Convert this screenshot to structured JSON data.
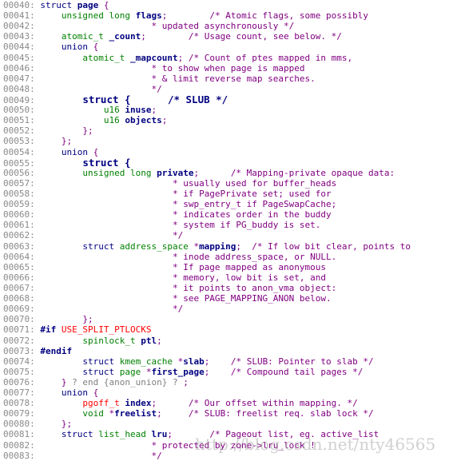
{
  "watermark": "http://blog.csdn.net/nty46565",
  "lines": [
    {
      "num": "00040:",
      "tokens": [
        [
          "k",
          "struct "
        ],
        [
          "i",
          "page"
        ],
        [
          "p",
          " {"
        ]
      ]
    },
    {
      "num": "00041:",
      "tokens": [
        [
          "s",
          "    "
        ],
        [
          "t",
          "unsigned long "
        ],
        [
          "i",
          "flags"
        ],
        [
          "p",
          ";"
        ],
        [
          "s",
          "        "
        ],
        [
          "c",
          "/* Atomic flags, some possibly"
        ]
      ]
    },
    {
      "num": "00042:",
      "tokens": [
        [
          "s",
          "                     "
        ],
        [
          "c",
          "* updated asynchronously */"
        ]
      ]
    },
    {
      "num": "00043:",
      "tokens": [
        [
          "s",
          "    "
        ],
        [
          "t",
          "atomic_t "
        ],
        [
          "i",
          "_count"
        ],
        [
          "p",
          ";"
        ],
        [
          "s",
          "        "
        ],
        [
          "c",
          "/* Usage count, see below. */"
        ]
      ]
    },
    {
      "num": "00044:",
      "tokens": [
        [
          "s",
          "    "
        ],
        [
          "k",
          "union"
        ],
        [
          "p",
          " {"
        ]
      ]
    },
    {
      "num": "00045:",
      "tokens": [
        [
          "s",
          "        "
        ],
        [
          "t",
          "atomic_t "
        ],
        [
          "i",
          "_mapcount"
        ],
        [
          "p",
          "; "
        ],
        [
          "c",
          "/* Count of ptes mapped in mms,"
        ]
      ]
    },
    {
      "num": "00046:",
      "tokens": [
        [
          "s",
          "                     "
        ],
        [
          "c",
          "* to show when page is mapped"
        ]
      ]
    },
    {
      "num": "00047:",
      "tokens": [
        [
          "s",
          "                     "
        ],
        [
          "c",
          "* & limit reverse map searches."
        ]
      ]
    },
    {
      "num": "00048:",
      "tokens": [
        [
          "s",
          "                     "
        ],
        [
          "c",
          "*/"
        ]
      ]
    },
    {
      "num": "00049:",
      "tokens": [
        [
          "s",
          "        "
        ],
        [
          "kb",
          "struct {"
        ],
        [
          "s",
          "       "
        ],
        [
          "kb",
          "/* SLUB */"
        ]
      ]
    },
    {
      "num": "00050:",
      "tokens": [
        [
          "s",
          "            "
        ],
        [
          "t",
          "u16 "
        ],
        [
          "i",
          "inuse"
        ],
        [
          "p",
          ";"
        ]
      ]
    },
    {
      "num": "00051:",
      "tokens": [
        [
          "s",
          "            "
        ],
        [
          "t",
          "u16 "
        ],
        [
          "i",
          "objects"
        ],
        [
          "p",
          ";"
        ]
      ]
    },
    {
      "num": "00052:",
      "tokens": [
        [
          "s",
          "        "
        ],
        [
          "p",
          "};"
        ]
      ]
    },
    {
      "num": "00053:",
      "tokens": [
        [
          "s",
          "    "
        ],
        [
          "p",
          "};"
        ]
      ]
    },
    {
      "num": "00054:",
      "tokens": [
        [
          "s",
          "    "
        ],
        [
          "k",
          "union"
        ],
        [
          "p",
          " {"
        ]
      ]
    },
    {
      "num": "00055:",
      "tokens": [
        [
          "s",
          "        "
        ],
        [
          "kb",
          "struct {"
        ]
      ]
    },
    {
      "num": "00056:",
      "tokens": [
        [
          "s",
          "        "
        ],
        [
          "t",
          "unsigned long "
        ],
        [
          "i",
          "private"
        ],
        [
          "p",
          ";"
        ],
        [
          "s",
          "      "
        ],
        [
          "c",
          "/* Mapping-private opaque data:"
        ]
      ]
    },
    {
      "num": "00057:",
      "tokens": [
        [
          "s",
          "                         "
        ],
        [
          "c",
          "* usually used for buffer_heads"
        ]
      ]
    },
    {
      "num": "00058:",
      "tokens": [
        [
          "s",
          "                         "
        ],
        [
          "c",
          "* if PagePrivate set; used for"
        ]
      ]
    },
    {
      "num": "00059:",
      "tokens": [
        [
          "s",
          "                         "
        ],
        [
          "c",
          "* swp_entry_t if PageSwapCache;"
        ]
      ]
    },
    {
      "num": "00060:",
      "tokens": [
        [
          "s",
          "                         "
        ],
        [
          "c",
          "* indicates order in the buddy"
        ]
      ]
    },
    {
      "num": "00061:",
      "tokens": [
        [
          "s",
          "                         "
        ],
        [
          "c",
          "* system if PG_buddy is set."
        ]
      ]
    },
    {
      "num": "00062:",
      "tokens": [
        [
          "s",
          "                         "
        ],
        [
          "c",
          "*/"
        ]
      ]
    },
    {
      "num": "00063:",
      "tokens": [
        [
          "s",
          "        "
        ],
        [
          "k",
          "struct "
        ],
        [
          "t",
          "address_space "
        ],
        [
          "p",
          "*"
        ],
        [
          "i",
          "mapping"
        ],
        [
          "p",
          ";"
        ],
        [
          "s",
          "  "
        ],
        [
          "c",
          "/* If low bit clear, points to"
        ]
      ]
    },
    {
      "num": "00064:",
      "tokens": [
        [
          "s",
          "                         "
        ],
        [
          "c",
          "* inode address_space, or NULL."
        ]
      ]
    },
    {
      "num": "00065:",
      "tokens": [
        [
          "s",
          "                         "
        ],
        [
          "c",
          "* If page mapped as anonymous"
        ]
      ]
    },
    {
      "num": "00066:",
      "tokens": [
        [
          "s",
          "                         "
        ],
        [
          "c",
          "* memory, low bit is set, and"
        ]
      ]
    },
    {
      "num": "00067:",
      "tokens": [
        [
          "s",
          "                         "
        ],
        [
          "c",
          "* it points to anon_vma object:"
        ]
      ]
    },
    {
      "num": "00068:",
      "tokens": [
        [
          "s",
          "                         "
        ],
        [
          "c",
          "* see PAGE_MAPPING_ANON below."
        ]
      ]
    },
    {
      "num": "00069:",
      "tokens": [
        [
          "s",
          "                         "
        ],
        [
          "c",
          "*/"
        ]
      ]
    },
    {
      "num": "00070:",
      "tokens": [
        [
          "s",
          "        "
        ],
        [
          "p",
          "};"
        ]
      ]
    },
    {
      "num": "00071:",
      "tokens": [
        [
          "pp",
          "#if "
        ],
        [
          "r",
          "USE_SPLIT_PTLOCKS"
        ]
      ]
    },
    {
      "num": "00072:",
      "tokens": [
        [
          "s",
          "        "
        ],
        [
          "t",
          "spinlock_t "
        ],
        [
          "i",
          "ptl"
        ],
        [
          "p",
          ";"
        ]
      ]
    },
    {
      "num": "00073:",
      "tokens": [
        [
          "pp",
          "#endif"
        ]
      ]
    },
    {
      "num": "00074:",
      "tokens": [
        [
          "s",
          "        "
        ],
        [
          "k",
          "struct "
        ],
        [
          "t",
          "kmem_cache "
        ],
        [
          "p",
          "*"
        ],
        [
          "i",
          "slab"
        ],
        [
          "p",
          ";"
        ],
        [
          "s",
          "    "
        ],
        [
          "c",
          "/* SLUB: Pointer to slab */"
        ]
      ]
    },
    {
      "num": "00075:",
      "tokens": [
        [
          "s",
          "        "
        ],
        [
          "k",
          "struct "
        ],
        [
          "t",
          "page "
        ],
        [
          "p",
          "*"
        ],
        [
          "i",
          "first_page"
        ],
        [
          "p",
          ";"
        ],
        [
          "s",
          "    "
        ],
        [
          "c",
          "/* Compound tail pages */"
        ]
      ]
    },
    {
      "num": "00076:",
      "tokens": [
        [
          "s",
          "    "
        ],
        [
          "p",
          "}"
        ],
        [
          "g",
          " ? end {anon_union} ? "
        ],
        [
          "p",
          ";"
        ]
      ]
    },
    {
      "num": "00077:",
      "tokens": [
        [
          "s",
          "    "
        ],
        [
          "k",
          "union"
        ],
        [
          "p",
          " {"
        ]
      ]
    },
    {
      "num": "00078:",
      "tokens": [
        [
          "s",
          "        "
        ],
        [
          "r",
          "pgoff_t "
        ],
        [
          "i",
          "index"
        ],
        [
          "p",
          ";"
        ],
        [
          "s",
          "      "
        ],
        [
          "c",
          "/* Our offset within mapping. */"
        ]
      ]
    },
    {
      "num": "00079:",
      "tokens": [
        [
          "s",
          "        "
        ],
        [
          "t",
          "void "
        ],
        [
          "p",
          "*"
        ],
        [
          "i",
          "freelist"
        ],
        [
          "p",
          ";"
        ],
        [
          "s",
          "     "
        ],
        [
          "c",
          "/* SLUB: freelist req. slab lock */"
        ]
      ]
    },
    {
      "num": "00080:",
      "tokens": [
        [
          "s",
          "    "
        ],
        [
          "p",
          "};"
        ]
      ]
    },
    {
      "num": "00081:",
      "tokens": [
        [
          "s",
          "    "
        ],
        [
          "k",
          "struct "
        ],
        [
          "t",
          "list_head "
        ],
        [
          "i",
          "lru"
        ],
        [
          "p",
          ";"
        ],
        [
          "s",
          "       "
        ],
        [
          "c",
          "/* Pageout list, eg. active_list"
        ]
      ]
    },
    {
      "num": "00082:",
      "tokens": [
        [
          "s",
          "                     "
        ],
        [
          "c",
          "* protected by zone->lru_lock !"
        ]
      ]
    },
    {
      "num": "00083:",
      "tokens": [
        [
          "s",
          "                     "
        ],
        [
          "c",
          "*/"
        ]
      ]
    }
  ]
}
